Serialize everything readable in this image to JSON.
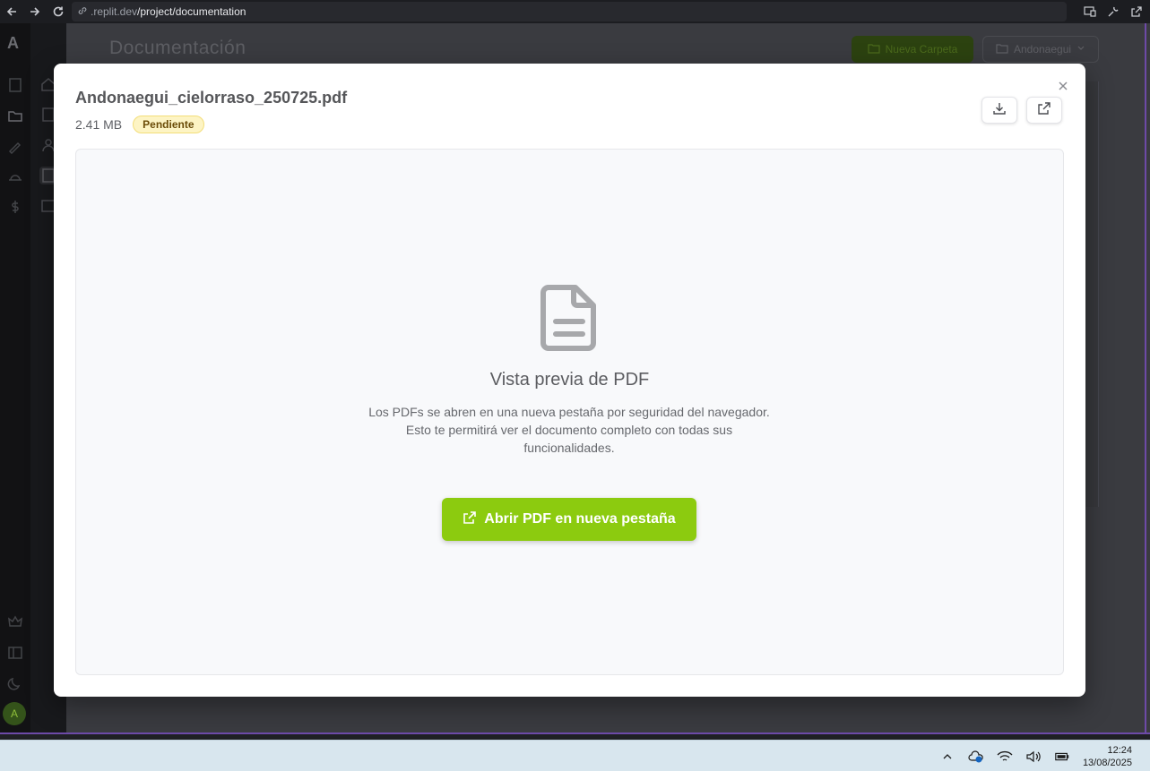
{
  "browser": {
    "url_host": ".replit.dev",
    "url_path": "/project/documentation"
  },
  "app": {
    "logo": "A",
    "page_title": "Documentación",
    "new_folder_label": "Nueva Carpeta",
    "project_selector_label": "Andonaegui",
    "avatar_initial": "A"
  },
  "modal": {
    "file_name": "Andonaegui_cielorraso_250725.pdf",
    "file_size": "2.41 MB",
    "status": "Pendiente",
    "preview_heading": "Vista previa de PDF",
    "preview_description": "Los PDFs se abren en una nueva pestaña por seguridad del navegador. Esto te permitirá ver el documento completo con todas sus funcionalidades.",
    "open_button_label": "Abrir PDF en nueva pestaña"
  },
  "taskbar": {
    "time": "12:24",
    "date": "13/08/2025"
  },
  "colors": {
    "accent_green": "#8ccb0f",
    "badge_bg": "#fdf4c4",
    "badge_text": "#6b4c08",
    "frame_purple": "#6d4aa8"
  }
}
